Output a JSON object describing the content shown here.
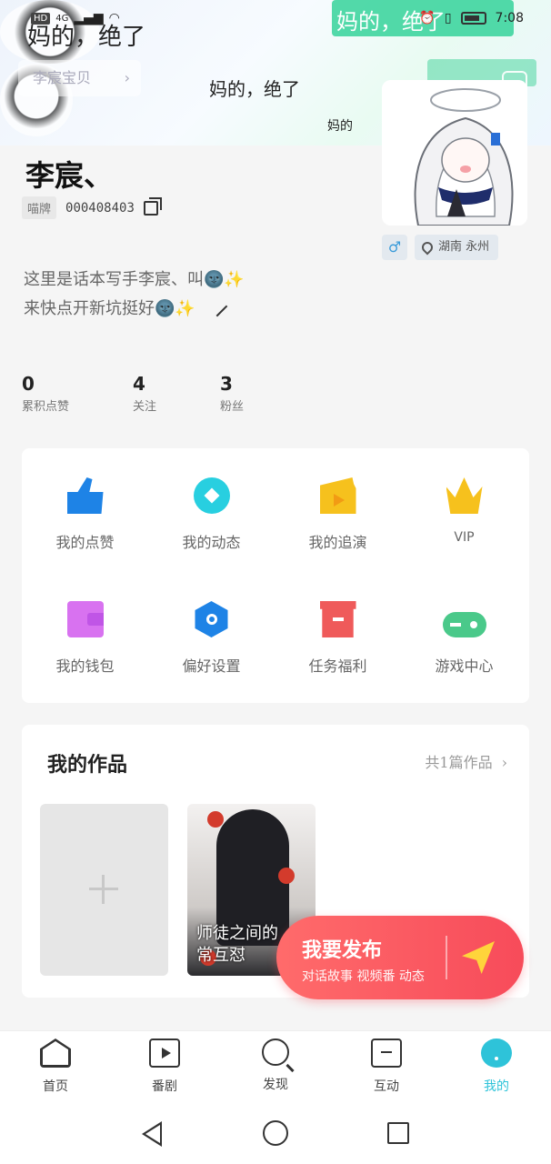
{
  "status_bar": {
    "network": "HD",
    "signal": "4G",
    "time": "7:08"
  },
  "banner": {
    "sticker_text_1": "妈的，绝了",
    "sticker_text_2": "妈的，绝了",
    "sticker_text_3": "妈的，绝了",
    "sticker_text_4": "妈的",
    "button_label": "李宸宝贝"
  },
  "profile": {
    "name": "李宸、",
    "id_tag": "喵牌",
    "id_number": "000408403",
    "gender_symbol": "♂",
    "location": "湖南 永州",
    "bio_line_1": "这里是话本写手李宸、叫🌚✨",
    "bio_line_2": "来快点开新坑挺好🌚✨"
  },
  "stats": [
    {
      "num": "0",
      "label": "累积点赞"
    },
    {
      "num": "4",
      "label": "关注"
    },
    {
      "num": "3",
      "label": "粉丝"
    }
  ],
  "grid": [
    {
      "label": "我的点赞",
      "icon": "thumb-up-icon"
    },
    {
      "label": "我的动态",
      "icon": "compass-icon"
    },
    {
      "label": "我的追演",
      "icon": "clapper-icon"
    },
    {
      "label": "VIP",
      "icon": "crown-icon"
    },
    {
      "label": "我的钱包",
      "icon": "wallet-icon"
    },
    {
      "label": "偏好设置",
      "icon": "settings-hex-icon"
    },
    {
      "label": "任务福利",
      "icon": "gift-box-icon"
    },
    {
      "label": "游戏中心",
      "icon": "gamepad-icon"
    }
  ],
  "works": {
    "title": "我的作品",
    "count_label": "共1篇作品",
    "items": [
      {
        "title_line_1": "师徒之间的",
        "title_line_2": "常互怼"
      }
    ]
  },
  "fab": {
    "title": "我要发布",
    "subtitle": "对话故事 视频番 动态"
  },
  "bottom_nav": [
    {
      "label": "首页",
      "icon": "home-icon"
    },
    {
      "label": "番剧",
      "icon": "play-icon"
    },
    {
      "label": "发现",
      "icon": "discover-icon"
    },
    {
      "label": "互动",
      "icon": "chat-icon"
    },
    {
      "label": "我的",
      "icon": "me-icon",
      "active": true
    }
  ],
  "colors": {
    "accent": "#2ec3d9",
    "fab": "#f74b5a",
    "thumb": "#1e83e6",
    "vip": "#f6c11d"
  }
}
